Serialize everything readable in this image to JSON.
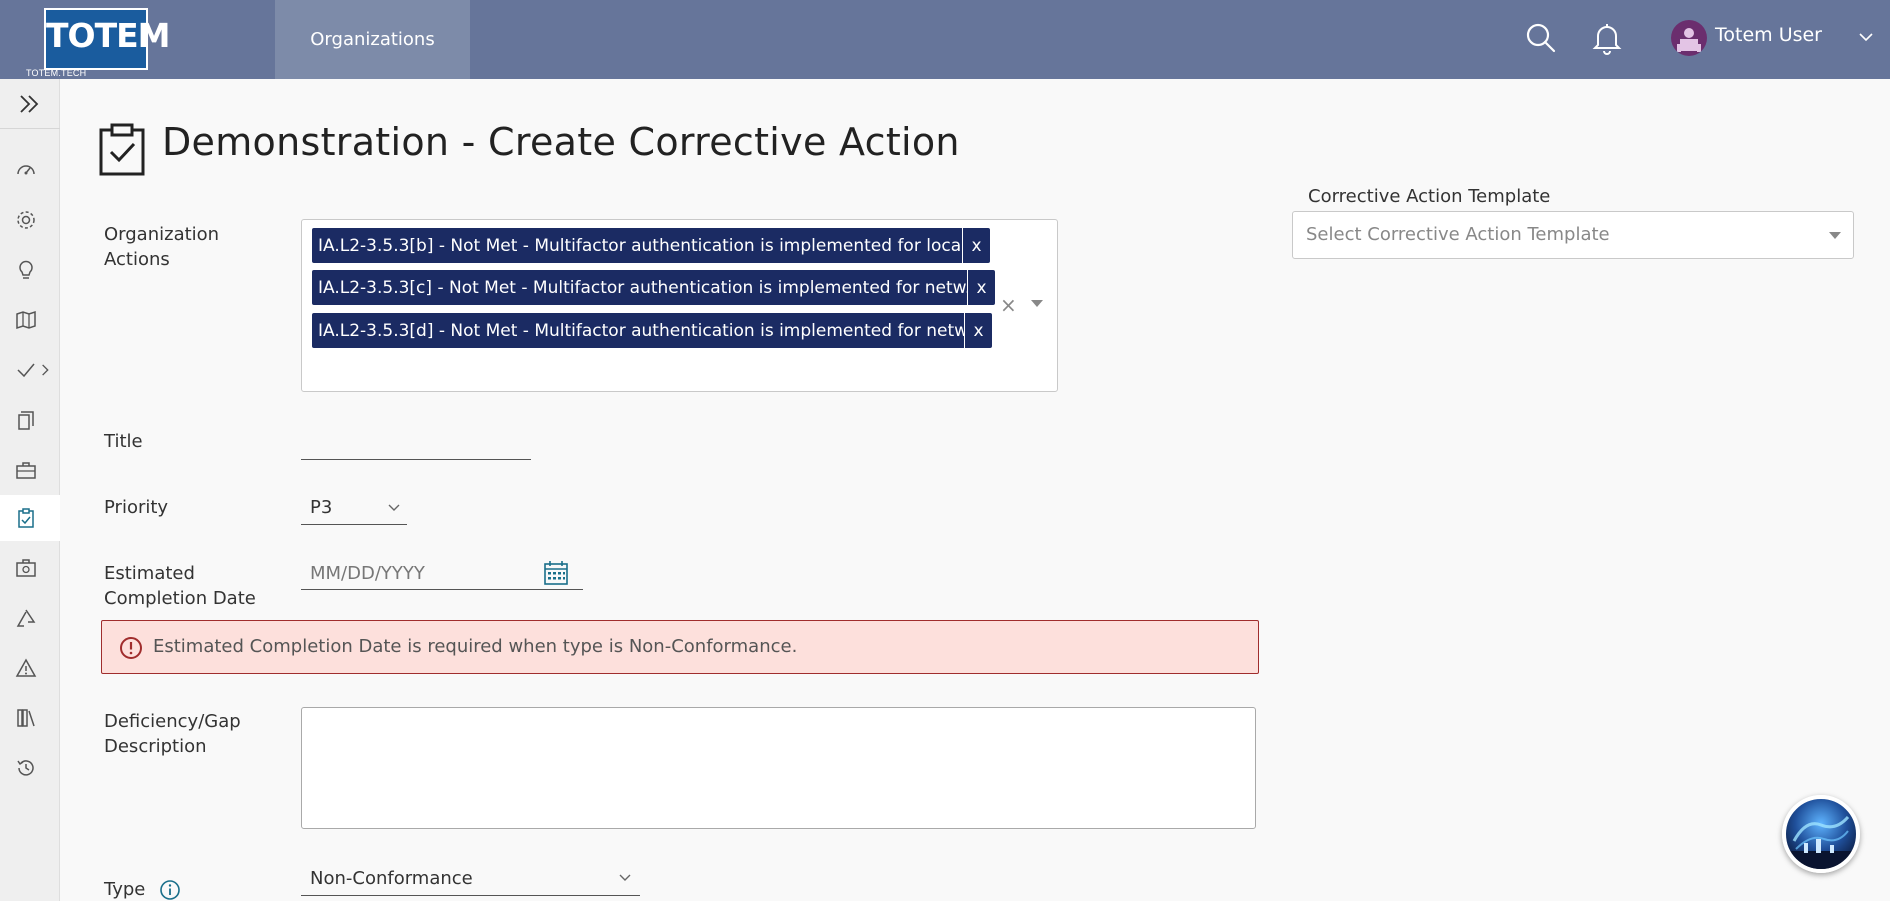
{
  "header": {
    "logo_text": "TOTEM",
    "logo_sub": "TOTEM.TECH",
    "nav_tab": "Organizations",
    "user_name": "Totem User"
  },
  "sidebar": {
    "items": [
      {
        "icon": "dashboard-icon"
      },
      {
        "icon": "gear-icon"
      },
      {
        "icon": "lightbulb-icon"
      },
      {
        "icon": "map-icon"
      },
      {
        "icon": "checkmark-icon"
      },
      {
        "icon": "document-icon"
      },
      {
        "icon": "briefcase-icon"
      },
      {
        "icon": "clipboard-check-icon",
        "active": true
      },
      {
        "icon": "first-aid-kit-icon"
      },
      {
        "icon": "recycle-icon"
      },
      {
        "icon": "warning-icon"
      },
      {
        "icon": "library-icon"
      },
      {
        "icon": "history-icon"
      }
    ]
  },
  "page": {
    "title": "Demonstration - Create Corrective Action"
  },
  "form": {
    "org_actions_label": "Organization Actions",
    "chips": [
      "IA.L2-3.5.3[b] - Not Met - Multifactor authentication is implemented for loca...",
      "IA.L2-3.5.3[c] - Not Met - Multifactor authentication is implemented for netw...",
      "IA.L2-3.5.3[d] - Not Met - Multifactor authentication is implemented for netw..."
    ],
    "chip_remove": "x",
    "clear_all": "×",
    "title_label": "Title",
    "title_value": "",
    "priority_label": "Priority",
    "priority_value": "P3",
    "date_label": "Estimated Completion Date",
    "date_placeholder": "MM/DD/YYYY",
    "error_text": "Estimated Completion Date is required when type is Non-Conformance.",
    "deficiency_label": "Deficiency/Gap Description",
    "type_label": "Type",
    "type_value": "Non-Conformance"
  },
  "template": {
    "label": "Corrective Action Template",
    "placeholder": "Select Corrective Action Template"
  },
  "colors": {
    "topbar": "#66759a",
    "chip": "#1b2b63",
    "error_bg": "#fde0dc",
    "accent": "#1a6f8a"
  }
}
